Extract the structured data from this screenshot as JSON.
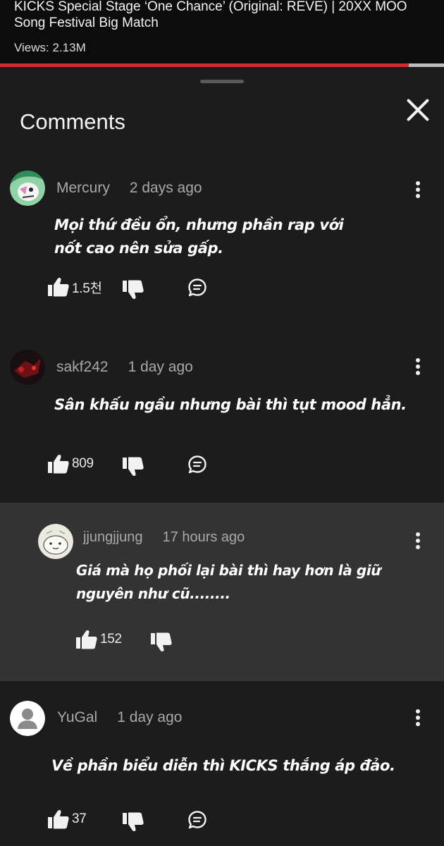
{
  "video": {
    "title": "KICKS Special Stage ‘One Chance’ (Original: REVE) | 20XX MOO Song Festival Big Match",
    "views": "Views: 2.13M",
    "progress_fraction": 0.92
  },
  "panel": {
    "title": "Comments",
    "close_icon": "close-icon"
  },
  "comments": [
    {
      "author": "Mercury",
      "time": "2 days ago",
      "text": "Mọi thứ đều ổn, nhưng phần rap với nốt cao nên sửa gấp.",
      "likes": "1.5천",
      "avatar": "mercury-avatar"
    },
    {
      "author": "sakf242",
      "time": "1 day ago",
      "text": "Sân khấu ngầu nhưng bài thì tụt mood hẳn.",
      "likes": "809",
      "avatar": "sakf242-avatar"
    },
    {
      "author": "jjungjjung",
      "time": "17 hours ago",
      "text": "Giá mà họ phối lại bài thì hay hơn là giữ nguyên như cũ........",
      "likes": "152",
      "avatar": "jjungjjung-avatar",
      "is_reply": true
    },
    {
      "author": "YuGal",
      "time": "1 day ago",
      "text": "Về phần biểu diễn thì KICKS thắng áp đảo.",
      "likes": "37",
      "avatar": "default-avatar"
    }
  ],
  "colors": {
    "background": "#1c1c1c",
    "topbar": "#0c0c0c",
    "reply_background": "#333333",
    "progress": "#d8292a",
    "meta_text": "#a9a9a9"
  }
}
